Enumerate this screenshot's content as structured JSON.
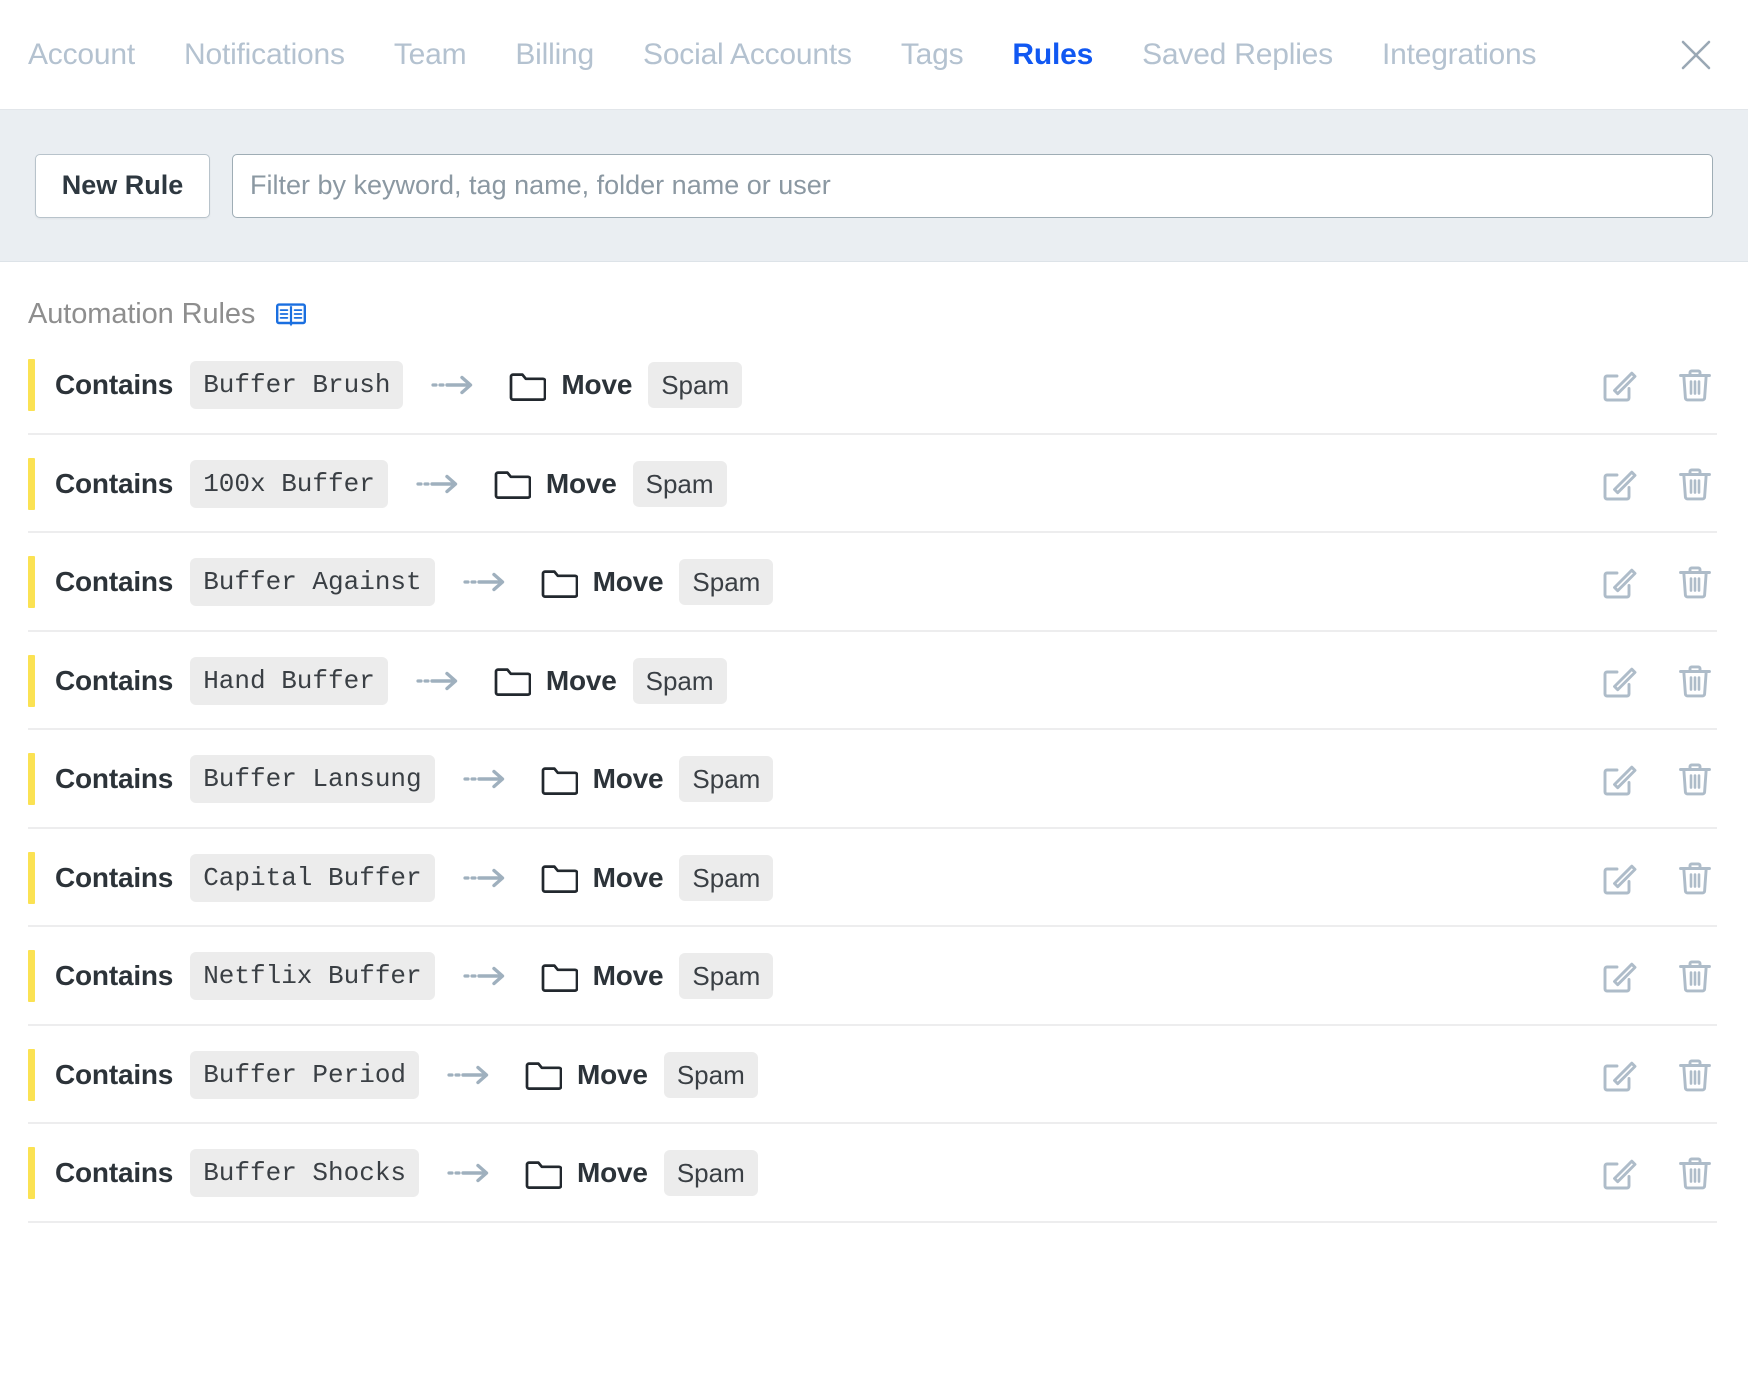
{
  "tabs": [
    {
      "label": "Account",
      "active": false
    },
    {
      "label": "Notifications",
      "active": false
    },
    {
      "label": "Team",
      "active": false
    },
    {
      "label": "Billing",
      "active": false
    },
    {
      "label": "Social Accounts",
      "active": false
    },
    {
      "label": "Tags",
      "active": false
    },
    {
      "label": "Rules",
      "active": true
    },
    {
      "label": "Saved Replies",
      "active": false
    },
    {
      "label": "Integrations",
      "active": false
    }
  ],
  "close_label": "×",
  "toolbar": {
    "new_rule_label": "New Rule",
    "filter_placeholder": "Filter by keyword, tag name, folder name or user",
    "filter_value": ""
  },
  "section": {
    "title": "Automation Rules",
    "help_icon": "book-icon"
  },
  "colors": {
    "accent_active_tab": "#1158f2",
    "tab_inactive": "#b4c2d0",
    "rule_bar_yellow": "#fbe253",
    "chip_bg": "#ececec",
    "toolbar_bg": "#eaeef2",
    "icon_blue_gray": "#aebcc9"
  },
  "rules": [
    {
      "condition": "Contains",
      "keyword": "Buffer Brush",
      "action": "Move",
      "target": "Spam"
    },
    {
      "condition": "Contains",
      "keyword": "100x Buffer",
      "action": "Move",
      "target": "Spam"
    },
    {
      "condition": "Contains",
      "keyword": "Buffer Against",
      "action": "Move",
      "target": "Spam"
    },
    {
      "condition": "Contains",
      "keyword": "Hand Buffer",
      "action": "Move",
      "target": "Spam"
    },
    {
      "condition": "Contains",
      "keyword": "Buffer Lansung",
      "action": "Move",
      "target": "Spam"
    },
    {
      "condition": "Contains",
      "keyword": "Capital Buffer",
      "action": "Move",
      "target": "Spam"
    },
    {
      "condition": "Contains",
      "keyword": "Netflix Buffer",
      "action": "Move",
      "target": "Spam"
    },
    {
      "condition": "Contains",
      "keyword": "Buffer Period",
      "action": "Move",
      "target": "Spam"
    },
    {
      "condition": "Contains",
      "keyword": "Buffer Shocks",
      "action": "Move",
      "target": "Spam"
    }
  ],
  "row_action_labels": {
    "edit": "edit-icon",
    "delete": "delete-icon"
  }
}
